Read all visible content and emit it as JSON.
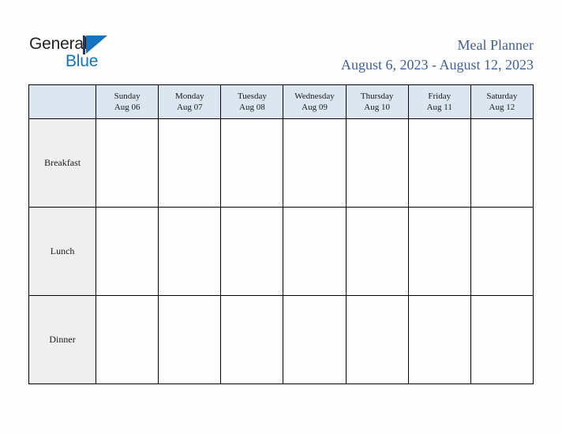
{
  "brand": {
    "word_dark": "General",
    "word_blue": "Blue",
    "mark": "triangle-logo",
    "dark_color": "#231f20",
    "blue_color": "#1573c0"
  },
  "header": {
    "title": "Meal Planner",
    "date_range": "August 6, 2023 - August 12, 2023",
    "title_color": "#3f5f99"
  },
  "table": {
    "corner_label": "",
    "header_bg": "#dce6f1",
    "label_bg": "#efefef",
    "cell_bg": "#fdfdfd",
    "border_color": "#000000",
    "columns": [
      {
        "dayname": "Sunday",
        "daydate": "Aug 06"
      },
      {
        "dayname": "Monday",
        "daydate": "Aug 07"
      },
      {
        "dayname": "Tuesday",
        "daydate": "Aug 08"
      },
      {
        "dayname": "Wednesday",
        "daydate": "Aug 09"
      },
      {
        "dayname": "Thursday",
        "daydate": "Aug 10"
      },
      {
        "dayname": "Friday",
        "daydate": "Aug 11"
      },
      {
        "dayname": "Saturday",
        "daydate": "Aug 12"
      }
    ],
    "rows": [
      {
        "label": "Breakfast",
        "cells": [
          "",
          "",
          "",
          "",
          "",
          "",
          ""
        ]
      },
      {
        "label": "Lunch",
        "cells": [
          "",
          "",
          "",
          "",
          "",
          "",
          ""
        ]
      },
      {
        "label": "Dinner",
        "cells": [
          "",
          "",
          "",
          "",
          "",
          "",
          ""
        ]
      }
    ]
  }
}
